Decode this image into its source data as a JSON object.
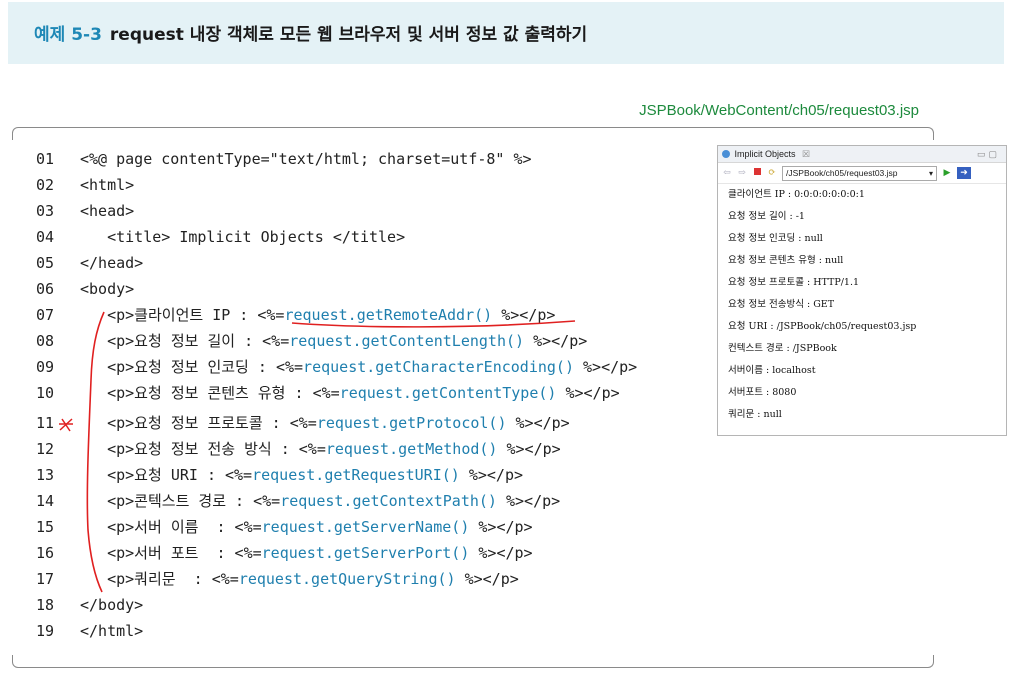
{
  "header": {
    "example_number": "예제 5-3",
    "title": "request 내장 객체로 모든 웹 브라우저 및 서버 정보 값 출력하기"
  },
  "file_path": "JSPBook/WebContent/ch05/request03.jsp",
  "code_lines": [
    {
      "num": "01",
      "pre": "<%@ page contentType=\"text/html; charset=utf-8\" %>",
      "hl": "",
      "post": ""
    },
    {
      "num": "02",
      "pre": "<html>",
      "hl": "",
      "post": ""
    },
    {
      "num": "03",
      "pre": "<head>",
      "hl": "",
      "post": ""
    },
    {
      "num": "04",
      "pre": "   <title> Implicit Objects </title>",
      "hl": "",
      "post": ""
    },
    {
      "num": "05",
      "pre": "</head>",
      "hl": "",
      "post": ""
    },
    {
      "num": "06",
      "pre": "<body>",
      "hl": "",
      "post": ""
    },
    {
      "num": "07",
      "pre": "   <p>클라이언트 IP : <%=",
      "hl": "request.getRemoteAddr()",
      "post": " %></p>"
    },
    {
      "num": "08",
      "pre": "   <p>요청 정보 길이 : <%=",
      "hl": "request.getContentLength()",
      "post": " %></p>"
    },
    {
      "num": "09",
      "pre": "   <p>요청 정보 인코딩 : <%=",
      "hl": "request.getCharacterEncoding()",
      "post": " %></p>"
    },
    {
      "num": "10",
      "pre": "   <p>요청 정보 콘텐츠 유형 : <%=",
      "hl": "request.getContentType()",
      "post": " %></p>"
    },
    {
      "num": "11",
      "pre": "   <p>요청 정보 프로토콜 : <%=",
      "hl": "request.getProtocol()",
      "post": " %></p>"
    },
    {
      "num": "12",
      "pre": "   <p>요청 정보 전송 방식 : <%=",
      "hl": "request.getMethod()",
      "post": " %></p>"
    },
    {
      "num": "13",
      "pre": "   <p>요청 URI : <%=",
      "hl": "request.getRequestURI()",
      "post": " %></p>"
    },
    {
      "num": "14",
      "pre": "   <p>콘텍스트 경로 : <%=",
      "hl": "request.getContextPath()",
      "post": " %></p>"
    },
    {
      "num": "15",
      "pre": "   <p>서버 이름  : <%=",
      "hl": "request.getServerName()",
      "post": " %></p>"
    },
    {
      "num": "16",
      "pre": "   <p>서버 포트  : <%=",
      "hl": "request.getServerPort()",
      "post": " %></p>"
    },
    {
      "num": "17",
      "pre": "   <p>쿼리문  : <%=",
      "hl": "request.getQueryString()",
      "post": " %></p>"
    },
    {
      "num": "18",
      "pre": "</body>",
      "hl": "",
      "post": ""
    },
    {
      "num": "19",
      "pre": "</html>",
      "hl": "",
      "post": ""
    }
  ],
  "browser": {
    "tab_title": "Implicit Objects",
    "tab_close": "☒",
    "url": "/JSPBook/ch05/request03.jsp",
    "lines": [
      "클라이언트 IP : 0:0:0:0:0:0:0:1",
      "요청 정보 길이 : -1",
      "요청 정보 인코딩 : null",
      "요청 정보 콘텐츠 유형 : null",
      "요청 정보 프로토콜 : HTTP/1.1",
      "요청 정보 전송방식 : GET",
      "요청 URI : /JSPBook/ch05/request03.jsp",
      "컨텍스트 경로 : /JSPBook",
      "서버이름 : localhost",
      "서버포트 : 8080",
      "쿼리문 : null"
    ]
  },
  "colors": {
    "header_bg": "#e4f2f6",
    "accent_blue": "#1e88b6",
    "path_green": "#1d8a3d",
    "annotation_red": "#e02020"
  }
}
